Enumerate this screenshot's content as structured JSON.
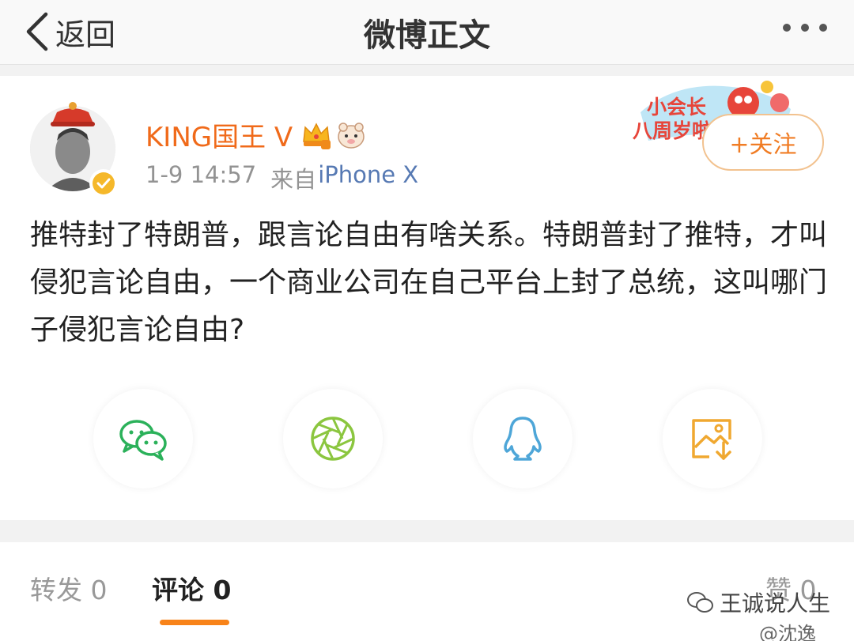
{
  "nav": {
    "back_label": "返回",
    "title": "微博正文"
  },
  "post": {
    "user_name": "KING国王 V",
    "time": "1-9 14:57",
    "source_prefix": "来自",
    "source": "iPhone X",
    "follow_label": "+关注",
    "banner_line1": "小会长",
    "banner_line2": "八周岁啦",
    "text": "推特封了特朗普，跟言论自由有啥关系。特朗普封了推特，才叫侵犯言论自由，一个商业公司在自己平台上封了总统，这叫哪门子侵犯言论自由?"
  },
  "share": [
    {
      "icon": "wechat-icon",
      "color": "#2bb15a"
    },
    {
      "icon": "moments-icon",
      "color": "#8bc63f"
    },
    {
      "icon": "qq-icon",
      "color": "#4ea6d8"
    },
    {
      "icon": "save-image-icon",
      "color": "#f0a830"
    }
  ],
  "tabs": {
    "repost": "转发 0",
    "comment": "评论 0",
    "like": "赞 0"
  },
  "watermark": {
    "account": "王诚说人生",
    "weibo": "@沈逸"
  },
  "colors": {
    "orange": "#f88319",
    "name": "#f06a1a",
    "link": "#5679b3"
  }
}
